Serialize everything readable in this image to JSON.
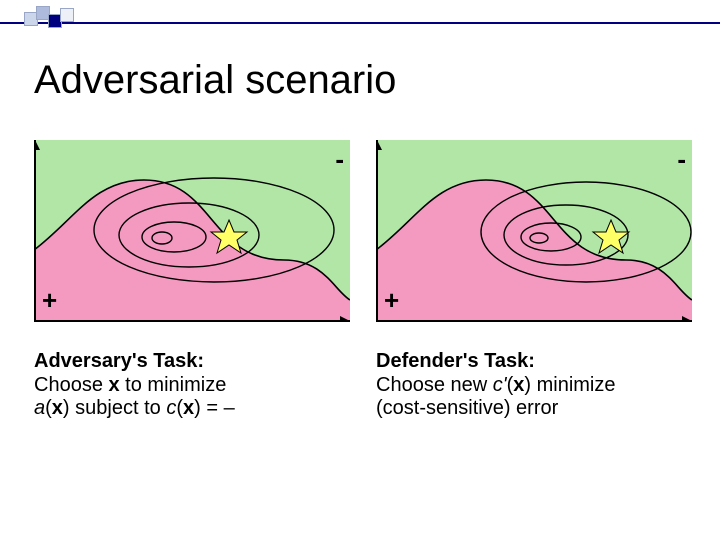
{
  "title": "Adversarial scenario",
  "left": {
    "plus": "+",
    "minus": "-",
    "heading": "Adversary's Task:",
    "line2a": "Choose ",
    "line2b": "x",
    "line2c": " to minimize",
    "line3a": "a",
    "line3b": "(",
    "line3c": "x",
    "line3d": ") subject to ",
    "line3e": "c",
    "line3f": "(",
    "line3g": "x",
    "line3h": ") = –"
  },
  "right": {
    "plus": "+",
    "minus": "-",
    "heading": "Defender's Task:",
    "line2a": "Choose new ",
    "line2b": "c'",
    "line2c": "(",
    "line2d": "x",
    "line2e": ") minimize",
    "line3": "(cost-sensitive) error"
  }
}
